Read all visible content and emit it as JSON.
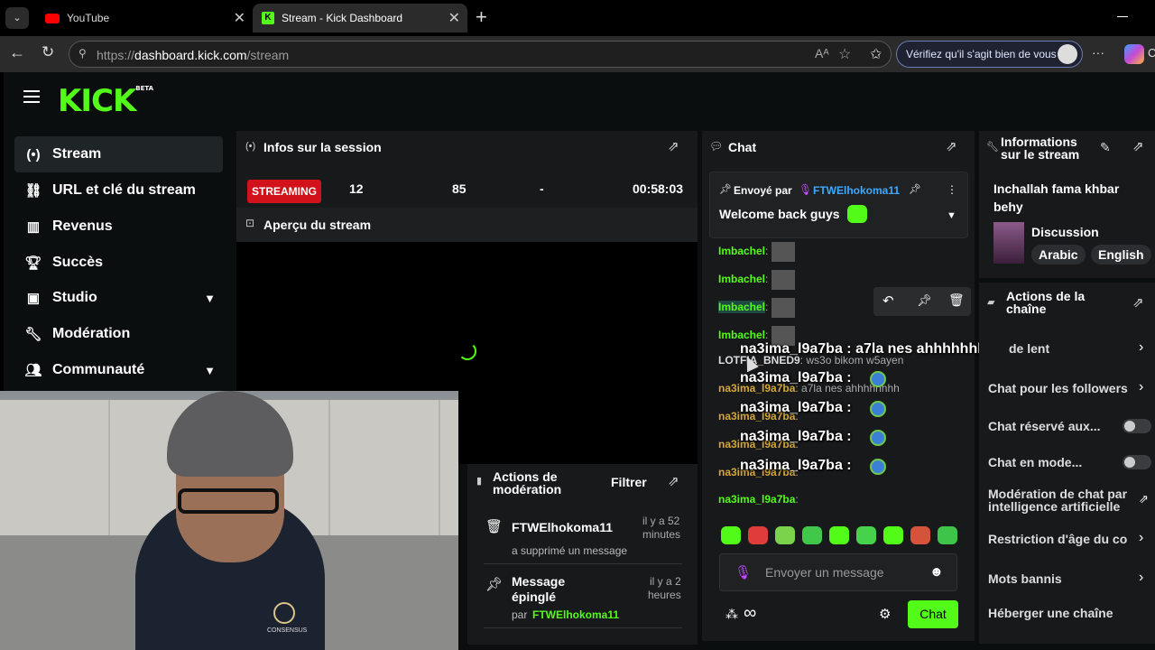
{
  "browser": {
    "tabs": [
      {
        "label": "YouTube"
      },
      {
        "label": "Stream - Kick Dashboard"
      }
    ],
    "url_prefix": "https://",
    "url_domain": "dashboard.kick.com",
    "url_path": "/stream",
    "verify_label": "Vérifiez qu'il s'agit bien de vous",
    "menu_dots": "···",
    "copilot_letter": "C"
  },
  "logo": {
    "text": "KICK",
    "badge": "BETA"
  },
  "sidebar": {
    "items": [
      {
        "label": "Stream"
      },
      {
        "label": "URL et clé du stream"
      },
      {
        "label": "Revenus"
      },
      {
        "label": "Succès"
      },
      {
        "label": "Studio"
      },
      {
        "label": "Modération"
      },
      {
        "label": "Communauté"
      }
    ]
  },
  "session": {
    "title": "Infos sur la session",
    "status": "STREAMING",
    "viewers": "12",
    "followers": "85",
    "dash": "-",
    "duration": "00:58:03",
    "preview_title": "Aperçu du stream"
  },
  "modactions": {
    "title_line1": "Actions de",
    "title_line2": "modération",
    "filter": "Filtrer",
    "items": [
      {
        "user": "FTWElhokoma11",
        "time1": "il y a 52",
        "time2": "minutes",
        "desc": "a supprimé un message"
      },
      {
        "title1": "Message",
        "title2": "épinglé",
        "time1": "il y a 2",
        "time2": "heures",
        "by": "par",
        "user": "FTWElhokoma11"
      }
    ]
  },
  "chat": {
    "title": "Chat",
    "pinned": {
      "sent_by": "Envoyé par",
      "user": "FTWElhokoma11",
      "message": "Welcome back guys"
    },
    "lines": [
      {
        "user": "Imbachel",
        "text": ":"
      },
      {
        "user": "Imbachel",
        "text": ":"
      },
      {
        "user": "Imbachel",
        "text": ":"
      },
      {
        "user": "Imbachel",
        "text": ":"
      },
      {
        "user": "LOTFIA_BNED9",
        "text": ": ws3o bikom w5ayen"
      },
      {
        "user": "na3ima_l9a7ba",
        "text": ": a7la nes ahhhhhhhh"
      },
      {
        "user": "na3ima_l9a7ba",
        "text": ":"
      },
      {
        "user": "na3ima_l9a7ba",
        "text": ":"
      },
      {
        "user": "na3ima_l9a7ba",
        "text": ":"
      },
      {
        "user": "na3ima_l9a7ba",
        "text": ":"
      }
    ],
    "overlays": [
      "na3ima_l9a7ba : a7la nes ahhhhhhhh",
      "na3ima_l9a7ba :",
      "na3ima_l9a7ba :",
      "na3ima_l9a7ba :",
      "na3ima_l9a7ba :"
    ],
    "input_placeholder": "Envoyer un message",
    "send_label": "Chat",
    "infinity": "∞"
  },
  "info": {
    "title_line1": "Informations",
    "title_line2": "sur le stream",
    "stream_title_line1": "Inchallah fama khbar",
    "stream_title_line2": "behy",
    "category": "Discussion",
    "tags": [
      "Arabic",
      "English"
    ]
  },
  "channel_actions": {
    "title_line1": "Actions de la",
    "title_line2": "chaîne",
    "rows": [
      "de lent",
      "Chat pour les followers",
      "Chat réservé aux...",
      "Chat en mode...",
      "Modération de chat par",
      "intelligence artificielle",
      "Restriction d'âge du co",
      "Mots bannis",
      "Héberger une chaîne"
    ]
  },
  "webcam": {
    "hoodie_text": "CONSENSUS"
  },
  "colors": {
    "accent": "#53fc18",
    "streaming": "#d2121a",
    "panel": "#18191b"
  }
}
